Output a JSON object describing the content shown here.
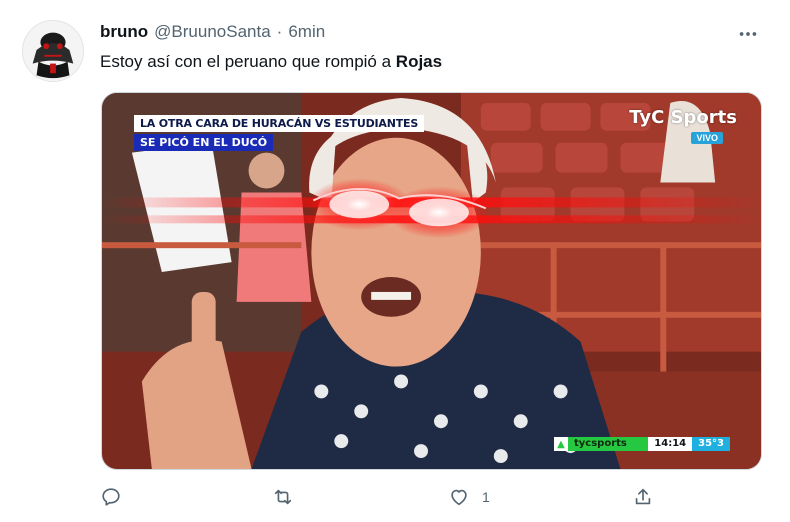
{
  "tweet": {
    "display_name": "bruno",
    "handle": "@BruunoSanta",
    "separator": "·",
    "time": "6min",
    "text_prefix": "Estoy así con el peruano que rompió a ",
    "text_bold": "Rojas"
  },
  "media": {
    "banner_top": "LA OTRA CARA DE HURACÁN VS ESTUDIANTES",
    "banner_bottom": "SE PICÓ EN EL DUCÓ",
    "logo": "TyC Sports",
    "live_label": "VIVO",
    "ticker_handle": "tycsports",
    "ticker_time": "14:14",
    "ticker_temp": "35°3"
  },
  "actions": {
    "reply_icon": "reply-icon",
    "retweet_icon": "retweet-icon",
    "like_icon": "heart-icon",
    "like_count": "1",
    "share_icon": "share-icon"
  },
  "colors": {
    "text_primary": "#0f1419",
    "text_secondary": "#536471",
    "laser_red": "#ff1a1a",
    "banner_blue": "#1a2bb8",
    "ticker_green": "#25c840"
  }
}
